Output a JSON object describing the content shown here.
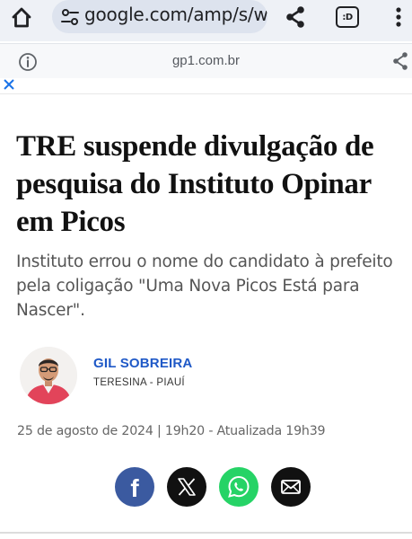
{
  "browser": {
    "url_text": "google.com/amp/s/ww",
    "tab_label": ":D",
    "icons": {
      "home": "home-icon",
      "site_settings": "tune-icon",
      "share": "share-icon",
      "tab_switcher": "tab-switcher-icon",
      "menu": "more-vert-icon"
    }
  },
  "amp_bar": {
    "domain": "gp1.com.br",
    "icons": {
      "info": "info-icon",
      "share": "share-icon"
    }
  },
  "close_bar": {
    "icon": "close-icon",
    "color": "#1a73e8"
  },
  "article": {
    "headline": "TRE suspende divulgação de pesquisa do Instituto Opinar em Picos",
    "subtitle": "Instituto errou o nome do candidato à prefeito pela coligação \"Uma Nova Picos Está para Nascer\".",
    "author": {
      "name": "GIL SOBREIRA",
      "location": "TERESINA - PIAUÍ",
      "name_color": "#1f59c7"
    },
    "date": "25 de agosto de 2024",
    "separator": "|",
    "time": "19h20 - Atualizada 19h39"
  },
  "social": [
    {
      "name": "facebook",
      "icon": "facebook-icon",
      "color": "#3b5aa0"
    },
    {
      "name": "x",
      "icon": "x-icon",
      "color": "#111111"
    },
    {
      "name": "whatsapp",
      "icon": "whatsapp-icon",
      "color": "#26d366"
    },
    {
      "name": "email",
      "icon": "mail-icon",
      "color": "#111111"
    }
  ]
}
